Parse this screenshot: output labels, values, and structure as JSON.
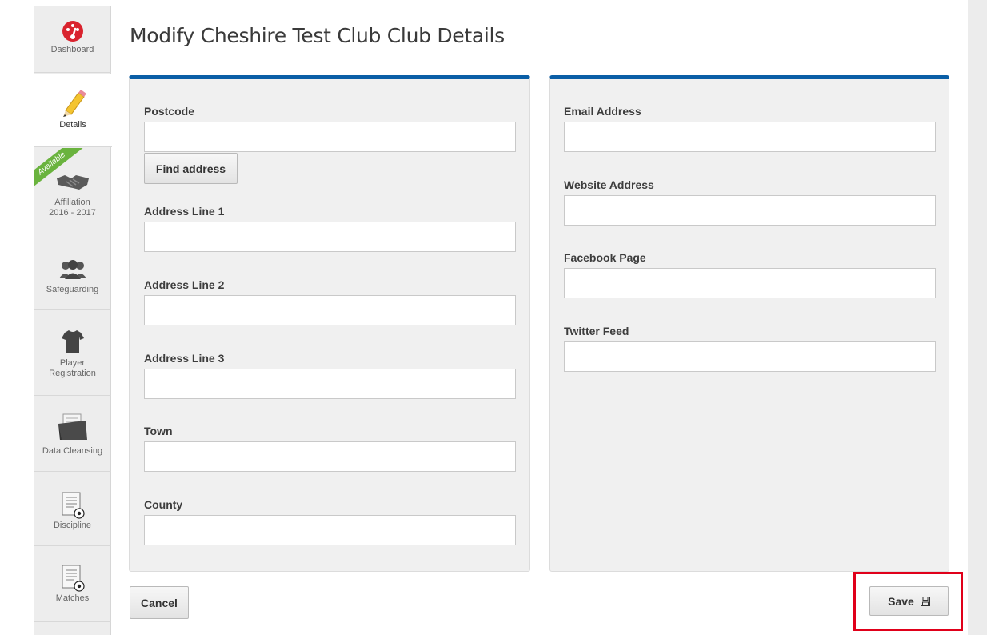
{
  "page": {
    "title": "Modify Cheshire Test Club Club Details"
  },
  "sidebar": {
    "items": [
      {
        "label": "Dashboard",
        "icon": "dashboard-icon"
      },
      {
        "label": "Details",
        "icon": "pencil-icon",
        "active": true
      },
      {
        "label_line1": "Affiliation",
        "label_line2": "2016 - 2017",
        "icon": "handshake-icon",
        "ribbon": "Available"
      },
      {
        "label": "Safeguarding",
        "icon": "people-icon"
      },
      {
        "label_line1": "Player",
        "label_line2": "Registration",
        "icon": "shirt-icon"
      },
      {
        "label": "Data Cleansing",
        "icon": "folder-icon"
      },
      {
        "label": "Discipline",
        "icon": "document-ball-icon"
      },
      {
        "label": "Matches",
        "icon": "document-ball-icon"
      }
    ]
  },
  "address_form": {
    "postcode": {
      "label": "Postcode",
      "value": ""
    },
    "find_address_label": "Find address",
    "line1": {
      "label": "Address Line 1",
      "value": ""
    },
    "line2": {
      "label": "Address Line 2",
      "value": ""
    },
    "line3": {
      "label": "Address Line 3",
      "value": ""
    },
    "town": {
      "label": "Town",
      "value": ""
    },
    "county": {
      "label": "County",
      "value": ""
    }
  },
  "contact_form": {
    "email": {
      "label": "Email Address",
      "value": ""
    },
    "website": {
      "label": "Website Address",
      "value": ""
    },
    "facebook": {
      "label": "Facebook Page",
      "value": ""
    },
    "twitter": {
      "label": "Twitter Feed",
      "value": ""
    }
  },
  "actions": {
    "cancel_label": "Cancel",
    "save_label": "Save"
  },
  "colors": {
    "accent": "#0a5ea6",
    "ribbon": "#6ab33e",
    "highlight": "#e0001a",
    "dashboard_red": "#d9232e"
  }
}
